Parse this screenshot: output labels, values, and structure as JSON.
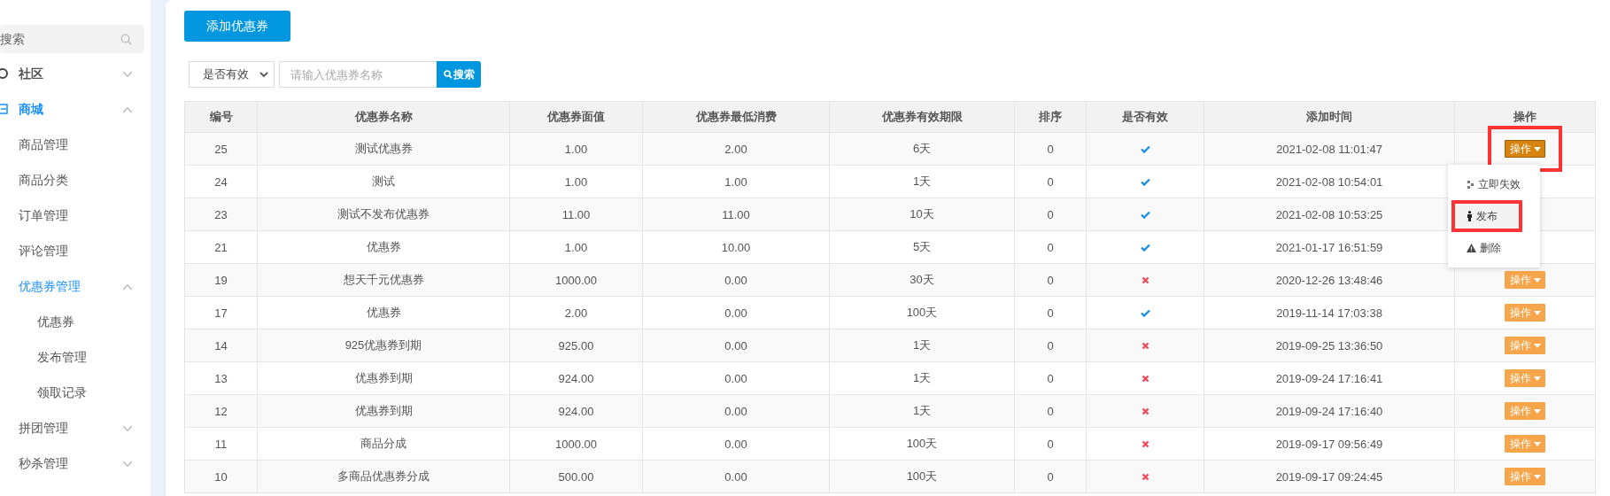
{
  "sidebar": {
    "search": {
      "placeholder": "搜索"
    },
    "items": [
      {
        "label": "社区",
        "kind": "community",
        "active": false,
        "expanded": false
      },
      {
        "label": "商城",
        "kind": "shop",
        "active": true,
        "expanded": true,
        "children": [
          {
            "label": "商品管理",
            "active": false
          },
          {
            "label": "商品分类",
            "active": false
          },
          {
            "label": "订单管理",
            "active": false
          },
          {
            "label": "评论管理",
            "active": false
          },
          {
            "label": "优惠券管理",
            "active": true,
            "expanded": true,
            "children": [
              {
                "label": "优惠券",
                "active": false
              },
              {
                "label": "发布管理",
                "active": false
              },
              {
                "label": "领取记录",
                "active": false
              }
            ]
          },
          {
            "label": "拼团管理",
            "active": false,
            "expanded": false
          },
          {
            "label": "秒杀管理",
            "active": false,
            "expanded": false
          }
        ]
      }
    ]
  },
  "toolbar": {
    "add_button": "添加优惠券",
    "filter": {
      "value": "是否有效"
    },
    "search": {
      "placeholder": "请输入优惠券名称",
      "button": "搜索"
    }
  },
  "table": {
    "columns": [
      "编号",
      "优惠券名称",
      "优惠券面值",
      "优惠券最低消费",
      "优惠券有效期限",
      "排序",
      "是否有效",
      "添加时间",
      "操作"
    ],
    "rows": [
      {
        "id": "25",
        "name": "测试优惠券",
        "value": "1.00",
        "min": "2.00",
        "days": "6天",
        "sort": "0",
        "valid": true,
        "time": "2021-02-08 11:01:47",
        "action": {
          "label": "操作",
          "open": true,
          "highlighted": true,
          "menu": [
            {
              "label": "立即失效",
              "kind": "expire",
              "hovered": false,
              "highlighted": false
            },
            {
              "label": "发布",
              "kind": "publish",
              "hovered": true,
              "highlighted": true
            },
            {
              "label": "删除",
              "kind": "delete",
              "hovered": false,
              "highlighted": false
            }
          ]
        }
      },
      {
        "id": "24",
        "name": "测试",
        "value": "1.00",
        "min": "1.00",
        "days": "1天",
        "sort": "0",
        "valid": true,
        "time": "2021-02-08 10:54:01"
      },
      {
        "id": "23",
        "name": "测试不发布优惠券",
        "value": "11.00",
        "min": "11.00",
        "days": "10天",
        "sort": "0",
        "valid": true,
        "time": "2021-02-08 10:53:25"
      },
      {
        "id": "21",
        "name": "优惠券",
        "value": "1.00",
        "min": "10.00",
        "days": "5天",
        "sort": "0",
        "valid": true,
        "time": "2021-01-17 16:51:59"
      },
      {
        "id": "19",
        "name": "想天千元优惠券",
        "value": "1000.00",
        "min": "0.00",
        "days": "30天",
        "sort": "0",
        "valid": false,
        "time": "2020-12-26 13:48:46",
        "action": {
          "label": "操作",
          "open": false
        }
      },
      {
        "id": "17",
        "name": "优惠券",
        "value": "2.00",
        "min": "0.00",
        "days": "100天",
        "sort": "0",
        "valid": true,
        "time": "2019-11-14 17:03:38",
        "action": {
          "label": "操作",
          "open": false
        }
      },
      {
        "id": "14",
        "name": "925优惠券到期",
        "value": "925.00",
        "min": "0.00",
        "days": "1天",
        "sort": "0",
        "valid": false,
        "time": "2019-09-25 13:36:50",
        "action": {
          "label": "操作",
          "open": false
        }
      },
      {
        "id": "13",
        "name": "优惠券到期",
        "value": "924.00",
        "min": "0.00",
        "days": "1天",
        "sort": "0",
        "valid": false,
        "time": "2019-09-24 17:16:41",
        "action": {
          "label": "操作",
          "open": false
        }
      },
      {
        "id": "12",
        "name": "优惠券到期",
        "value": "924.00",
        "min": "0.00",
        "days": "1天",
        "sort": "0",
        "valid": false,
        "time": "2019-09-24 17:16:40",
        "action": {
          "label": "操作",
          "open": false
        }
      },
      {
        "id": "11",
        "name": "商品分成",
        "value": "1000.00",
        "min": "0.00",
        "days": "100天",
        "sort": "0",
        "valid": false,
        "time": "2019-09-17 09:56:49",
        "action": {
          "label": "操作",
          "open": false
        }
      },
      {
        "id": "10",
        "name": "多商品优惠券分成",
        "value": "500.00",
        "min": "0.00",
        "days": "100天",
        "sort": "0",
        "valid": false,
        "time": "2019-09-17 09:24:45",
        "action": {
          "label": "操作",
          "open": false
        }
      }
    ]
  }
}
